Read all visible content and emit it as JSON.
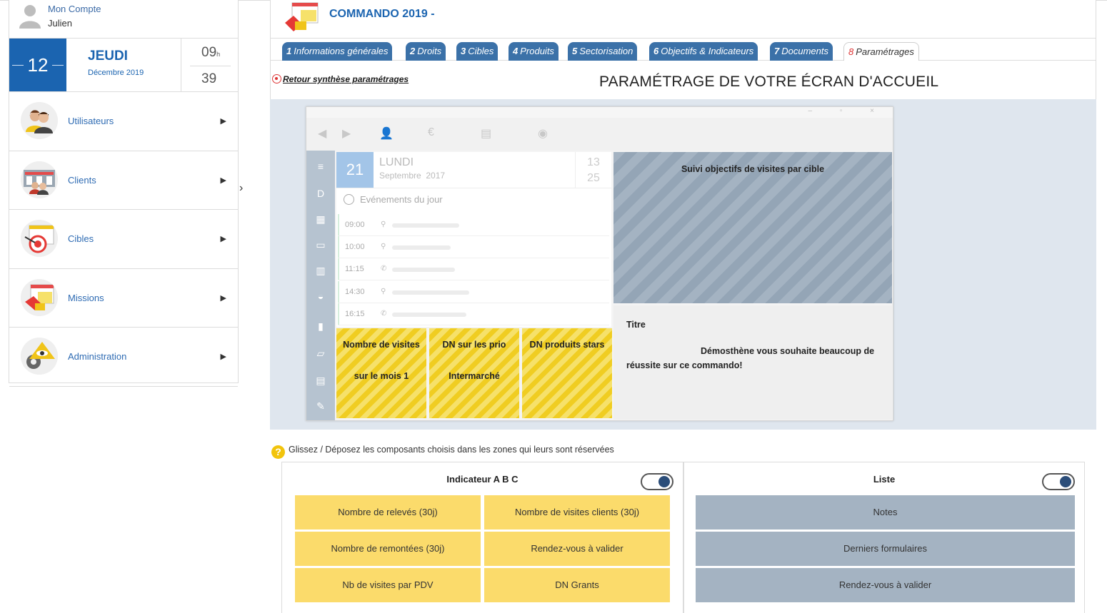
{
  "sidebar": {
    "account": {
      "label": "Mon Compte",
      "user": "Julien"
    },
    "date": {
      "day_number": "12",
      "day_name": "JEUDI",
      "month_year": "Décembre 2019",
      "hours": "09",
      "hours_suffix": "h",
      "minutes": "39"
    },
    "items": [
      {
        "label": "Utilisateurs",
        "icon": "users-icon"
      },
      {
        "label": "Clients",
        "icon": "clients-icon"
      },
      {
        "label": "Cibles",
        "icon": "target-icon"
      },
      {
        "label": "Missions",
        "icon": "missions-icon"
      },
      {
        "label": "Administration",
        "icon": "admin-icon"
      }
    ],
    "arrow": "▶",
    "collapse": "›"
  },
  "header": {
    "title": "COMMANDO 2019 -"
  },
  "tabs": [
    {
      "num": "1",
      "label": "Informations générales"
    },
    {
      "num": "2",
      "label": "Droits"
    },
    {
      "num": "3",
      "label": "Cibles"
    },
    {
      "num": "4",
      "label": "Produits"
    },
    {
      "num": "5",
      "label": "Sectorisation"
    },
    {
      "num": "6",
      "label": "Objectifs & Indicateurs"
    },
    {
      "num": "7",
      "label": "Documents"
    },
    {
      "num": "8",
      "label": "Paramétrages"
    }
  ],
  "subheader": {
    "back_link": "Retour synthèse paramétrages",
    "title": "PARAMÉTRAGE DE VOTRE ÉCRAN D'ACCUEIL"
  },
  "preview": {
    "window_controls": "– ▫ ×",
    "date": {
      "day_number": "21",
      "day_name": "LUNDI",
      "month": "Septembre",
      "year": "2017",
      "hours": "13",
      "minutes": "25"
    },
    "events_title": "Evénements du jour",
    "events": [
      {
        "time": "09:00",
        "kind": "person"
      },
      {
        "time": "10:00",
        "kind": "person"
      },
      {
        "time": "11:15",
        "kind": "phone"
      },
      {
        "time": "14:30",
        "kind": "person"
      },
      {
        "time": "16:15",
        "kind": "phone"
      }
    ],
    "tiles": [
      {
        "line1": "Nombre de visites",
        "line2": "sur le mois 1"
      },
      {
        "line1": "DN sur les prio",
        "line2": "Intermarché"
      },
      {
        "line1": "DN produits stars",
        "line2": ""
      }
    ],
    "chart_tile_title": "Suivi objectifs de visites par cible",
    "message_title": "Titre",
    "message_body": "Démosthène vous souhaite beaucoup de réussite sur ce commando!"
  },
  "hint": {
    "icon": "?",
    "text": "Glissez / Déposez les composants choisis dans les zones qui leurs sont réservées"
  },
  "panels": {
    "indicators": {
      "title": "Indicateur A B C",
      "items": [
        "Nombre de relevés (30j)",
        "Nombre de visites clients (30j)",
        "Nombre de remontées (30j)",
        "Rendez-vous à valider",
        "Nb de visites par PDV",
        "DN Grants"
      ]
    },
    "list": {
      "title": "Liste",
      "items": [
        "Notes",
        "Derniers formulaires",
        "Rendez-vous à valider"
      ]
    }
  },
  "colors": {
    "accent": "#1b64b0",
    "tab": "#3b71a8",
    "yellow": "#fbdb6b",
    "grey_blue": "#a4b3c2"
  }
}
